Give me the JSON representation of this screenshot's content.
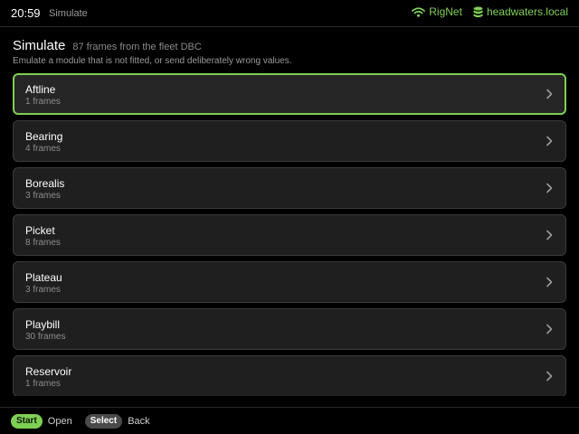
{
  "topbar": {
    "clock": "20:59",
    "breadcrumb": "Simulate",
    "network": {
      "label": "RigNet",
      "icon": "wifi-icon"
    },
    "host": {
      "label": "headwaters.local",
      "icon": "database-icon"
    }
  },
  "page": {
    "title": "Simulate",
    "subtitle": "87 frames from the fleet DBC",
    "description": "Emulate a module that is not fitted, or send deliberately wrong values."
  },
  "modules": [
    {
      "name": "Aftline",
      "frames": "1 frames",
      "selected": true
    },
    {
      "name": "Bearing",
      "frames": "4 frames"
    },
    {
      "name": "Borealis",
      "frames": "3 frames"
    },
    {
      "name": "Picket",
      "frames": "8 frames"
    },
    {
      "name": "Plateau",
      "frames": "3 frames"
    },
    {
      "name": "Playbill",
      "frames": "30 frames"
    },
    {
      "name": "Reservoir",
      "frames": "1 frames"
    }
  ],
  "footer": {
    "start_button": "Start",
    "start_hint": "Open",
    "select_button": "Select",
    "select_hint": "Back"
  },
  "colors": {
    "accent": "#7ecf54",
    "background": "#000000",
    "card": "#1f1f1f"
  }
}
